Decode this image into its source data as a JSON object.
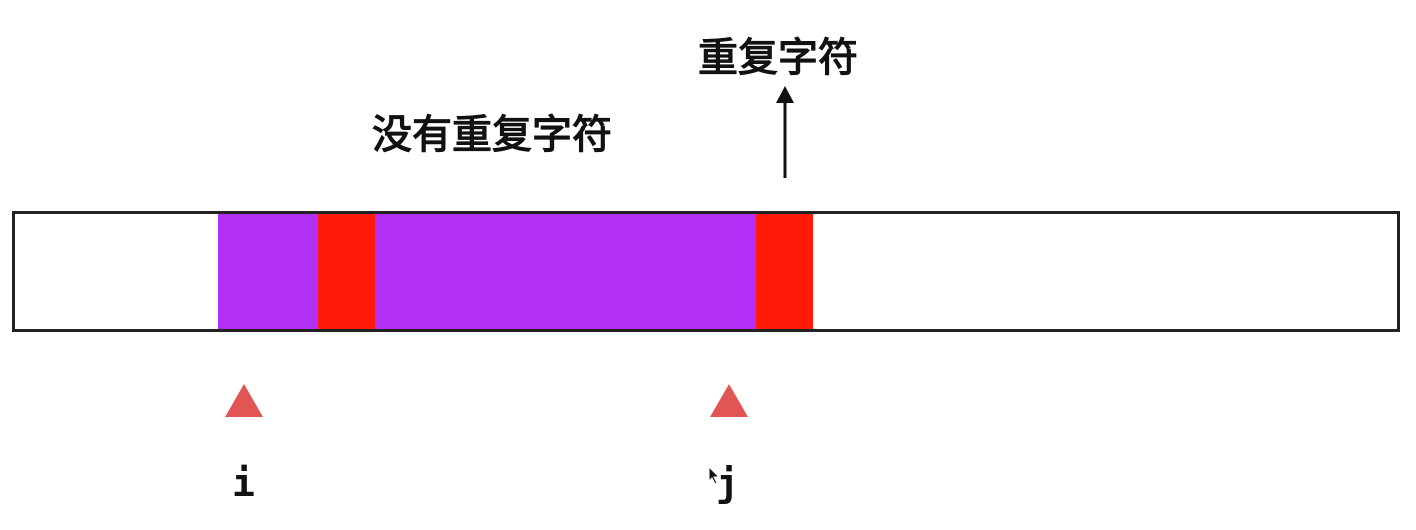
{
  "labels": {
    "repeat_char": "重复字符",
    "no_repeat_chars": "没有重复字符"
  },
  "pointers": {
    "i": "i",
    "j": "j"
  },
  "colors": {
    "window": "#b22ff5",
    "duplicate": "#ff1a0a",
    "pointer": "#e25555",
    "strip_border": "#222222",
    "text": "#111111"
  },
  "icons": {
    "arrow": "arrow-up-icon",
    "pointer": "triangle-up-icon",
    "cursor": "mouse-cursor-icon"
  }
}
